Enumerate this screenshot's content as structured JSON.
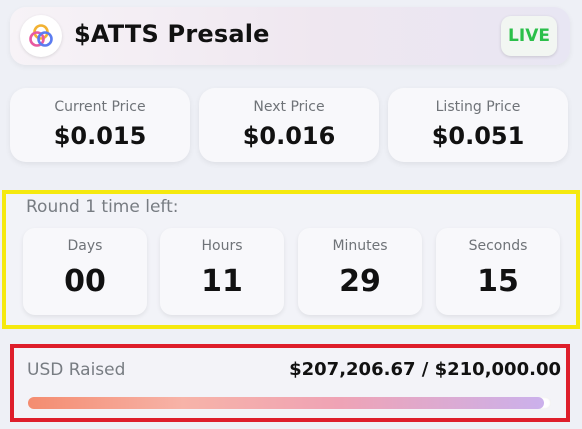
{
  "header": {
    "title": "$ATTS Presale",
    "status": "LIVE",
    "logo_icon": "token-rings-logo"
  },
  "prices": [
    {
      "label": "Current Price",
      "value": "$0.015"
    },
    {
      "label": "Next Price",
      "value": "$0.016"
    },
    {
      "label": "Listing Price",
      "value": "$0.051"
    }
  ],
  "countdown": {
    "title": "Round 1 time left:",
    "units": [
      {
        "label": "Days",
        "value": "00"
      },
      {
        "label": "Hours",
        "value": "11"
      },
      {
        "label": "Minutes",
        "value": "29"
      },
      {
        "label": "Seconds",
        "value": "15"
      }
    ]
  },
  "raised": {
    "label": "USD Raised",
    "value": "$207,206.67 / $210,000.00",
    "progress_fraction": 0.9867
  },
  "colors": {
    "live": "#2bbf4a",
    "timer_highlight": "#f5e90f",
    "raised_highlight": "#de1e2b"
  }
}
